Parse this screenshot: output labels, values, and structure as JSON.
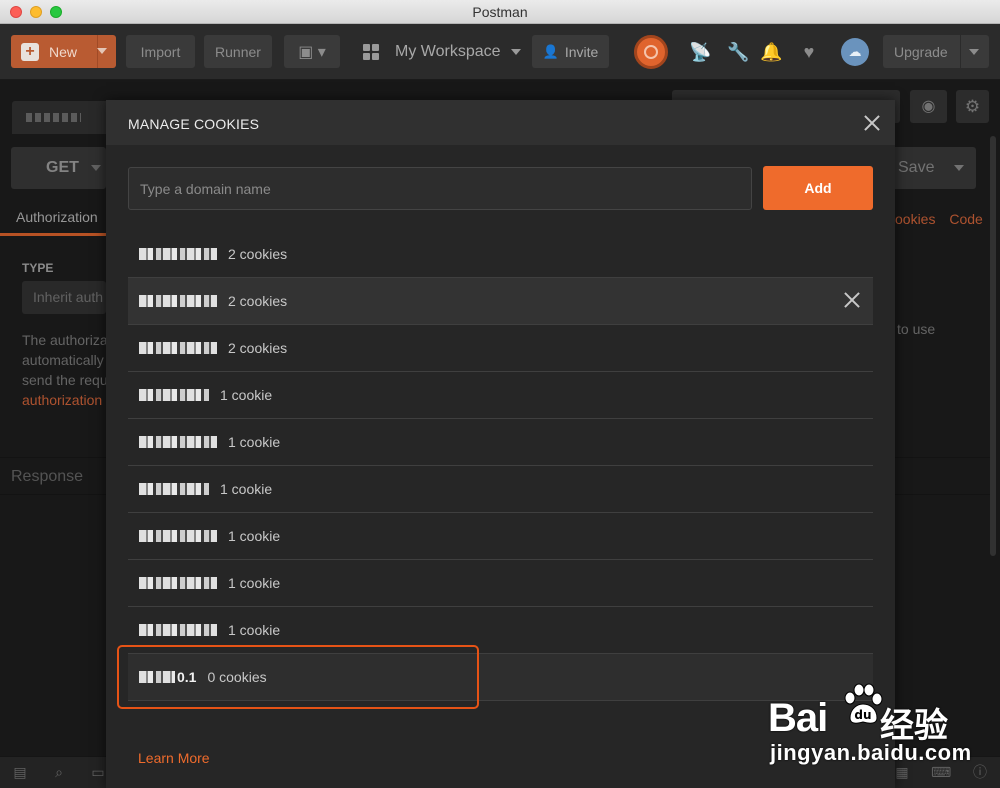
{
  "window": {
    "title": "Postman"
  },
  "toolbar": {
    "new_label": "New",
    "import_label": "Import",
    "runner_label": "Runner",
    "workspace_label": "My Workspace",
    "invite_label": "Invite",
    "upgrade_label": "Upgrade"
  },
  "request": {
    "method": "GET",
    "save_label": "Save",
    "tab_authorization": "Authorization",
    "tab_cookies": "ookies",
    "tab_code": "Code",
    "type_label": "TYPE",
    "type_value": "Inherit auth",
    "desc_lines": [
      "The authoriza",
      "automatically",
      "send the requ"
    ],
    "desc_link": "authorization",
    "desc_right": "to use",
    "response_label": "Response"
  },
  "modal": {
    "title": "MANAGE COOKIES",
    "domain_placeholder": "Type a domain name",
    "add_label": "Add",
    "learn_more": "Learn More",
    "domains": [
      {
        "name": "",
        "count": "2 cookies"
      },
      {
        "name": "",
        "count": "2 cookies"
      },
      {
        "name": "",
        "count": "2 cookies"
      },
      {
        "name": "",
        "count": "1 cookie"
      },
      {
        "name": "",
        "count": "1 cookie"
      },
      {
        "name": "",
        "count": "1 cookie"
      },
      {
        "name": "",
        "count": "1 cookie"
      },
      {
        "name": "",
        "count": "1 cookie"
      },
      {
        "name": "",
        "count": "1 cookie"
      },
      {
        "name": "0.1",
        "count": "0 cookies"
      }
    ]
  },
  "watermark": {
    "brand": "Bai",
    "brand_cn": "经验",
    "url": "jingyan.baidu.com"
  },
  "colors": {
    "accent": "#ef6b2c",
    "highlight": "#e65316"
  }
}
